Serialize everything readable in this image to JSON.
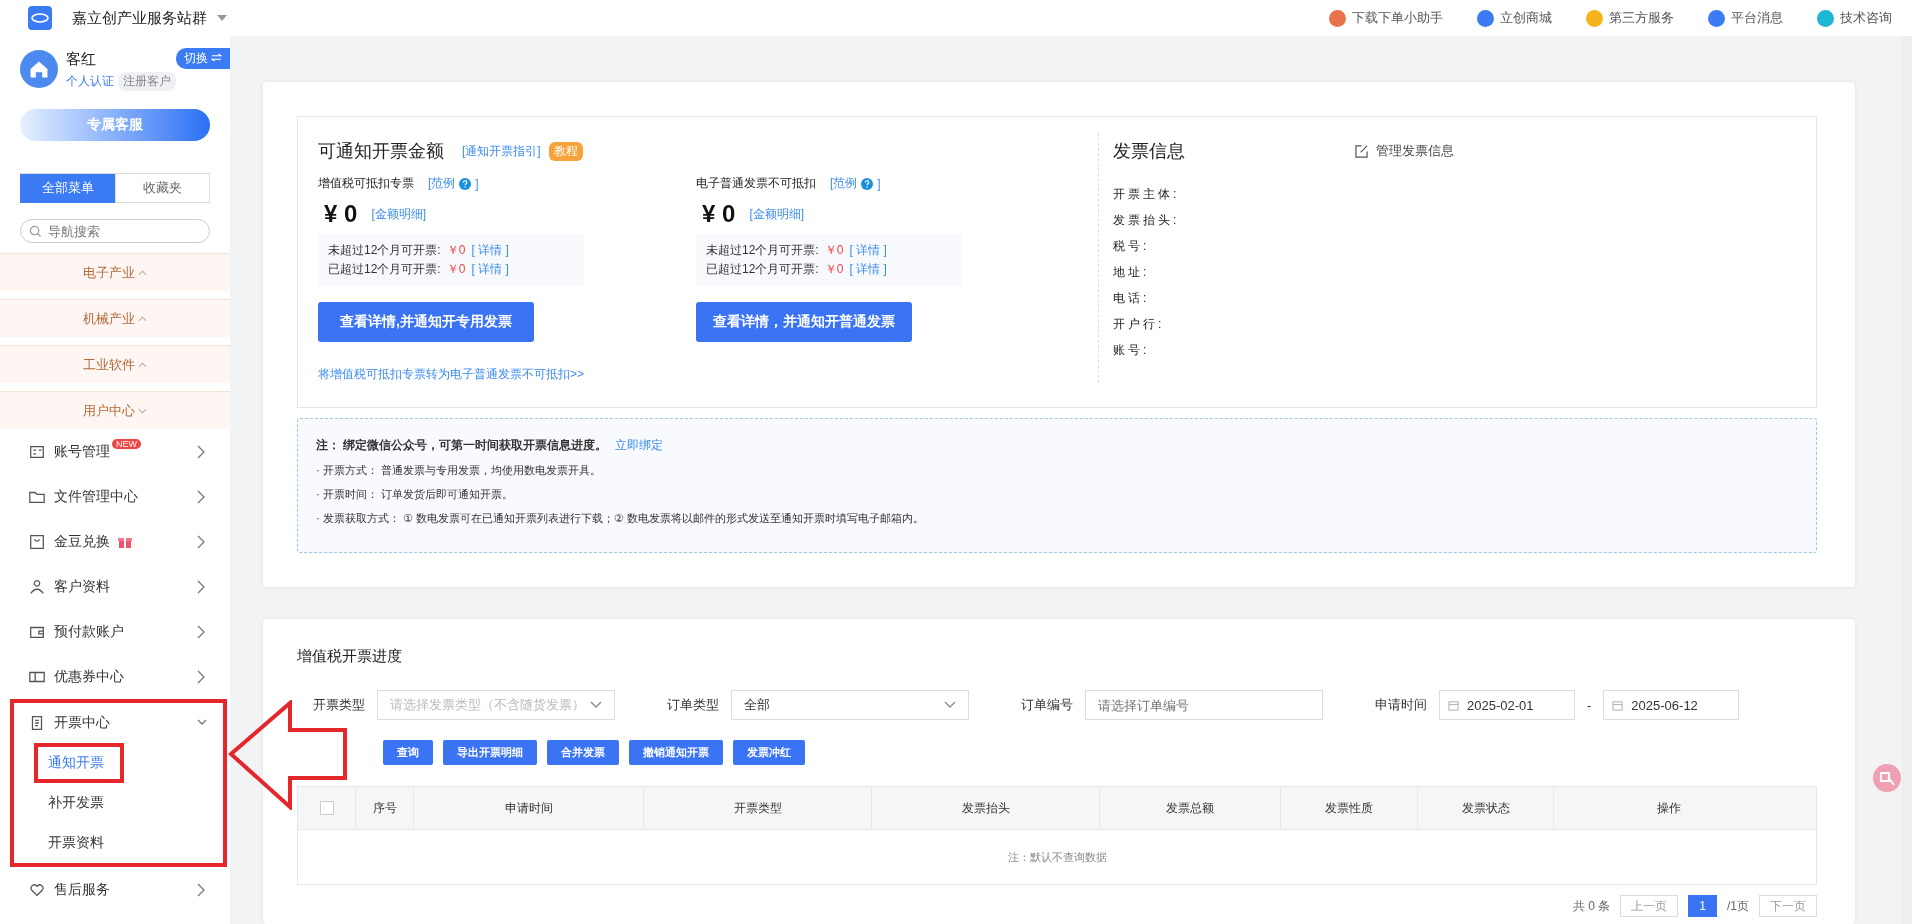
{
  "topbar": {
    "site": "嘉立创产业服务站群",
    "links": [
      {
        "label": "下载下单小助手",
        "color": "#e8734a"
      },
      {
        "label": "立创商城",
        "color": "#3b7cf5"
      },
      {
        "label": "第三方服务",
        "color": "#f5b31b"
      },
      {
        "label": "平台消息",
        "color": "#3b7cf5"
      },
      {
        "label": "技术咨询",
        "color": "#1fb7d6"
      }
    ]
  },
  "profile": {
    "name": "客红",
    "verify": "个人认证",
    "tag": "注册客户",
    "switch": "切换"
  },
  "service_button": "专属客服",
  "menu_tabs": [
    {
      "label": "全部菜单",
      "selected": true
    },
    {
      "label": "收藏夹",
      "selected": false
    }
  ],
  "nav_search": {
    "placeholder": "导航搜索"
  },
  "categories": [
    {
      "label": "电子产业",
      "expanded": false
    },
    {
      "label": "机械产业",
      "expanded": false
    },
    {
      "label": "工业软件",
      "expanded": false
    },
    {
      "label": "用户中心",
      "expanded": true
    }
  ],
  "menu": [
    {
      "label": "账号管理",
      "badge": "NEW",
      "gift": false,
      "expanded": false
    },
    {
      "label": "文件管理中心",
      "gift": false,
      "expanded": false
    },
    {
      "label": "金豆兑换",
      "gift": true,
      "expanded": false
    },
    {
      "label": "客户资料",
      "gift": false,
      "expanded": false
    },
    {
      "label": "预付款账户",
      "gift": false,
      "expanded": false
    },
    {
      "label": "优惠券中心",
      "gift": false,
      "expanded": false
    },
    {
      "label": "开票中心",
      "gift": false,
      "expanded": true,
      "annotated": true,
      "children": [
        {
          "label": "通知开票",
          "selected": true,
          "annotated": true
        },
        {
          "label": "补开发票",
          "selected": false,
          "annotated": false
        },
        {
          "label": "开票资料",
          "selected": false,
          "annotated": false
        }
      ]
    },
    {
      "label": "售后服务",
      "gift": false,
      "expanded": false
    }
  ],
  "amount": {
    "title": "可通知开票金额",
    "guide": "[通知开票指引]",
    "tutorial": "教程",
    "columns": [
      {
        "title": "增值税可抵扣专票",
        "example": "[范例",
        "example_end": "]",
        "total": "¥ 0",
        "detail": "[金额明细]",
        "lines": [
          {
            "label": "未超过12个月可开票:",
            "value": "￥0",
            "link": "[ 详情 ]"
          },
          {
            "label": "已超过12个月可开票:",
            "value": "￥0",
            "link": "[ 详情 ]"
          }
        ],
        "button": "查看详情,并通知开专用发票"
      },
      {
        "title": "电子普通发票不可抵扣",
        "example": "[范例",
        "example_end": "]",
        "total": "¥ 0",
        "detail": "[金额明细]",
        "lines": [
          {
            "label": "未超过12个月可开票:",
            "value": "￥0",
            "link": "[ 详情 ]"
          },
          {
            "label": "已超过12个月可开票:",
            "value": "￥0",
            "link": "[ 详情 ]"
          }
        ],
        "button": "查看详情，并通知开普通发票"
      }
    ],
    "convert_link": "将增值税可抵扣专票转为电子普通发票不可抵扣>>"
  },
  "invoice_info": {
    "title": "发票信息",
    "manage": "管理发票信息",
    "fields": [
      "开票主体:",
      "发票抬头:",
      "税号:",
      "地址:",
      "电话:",
      "开户行:",
      "账号:"
    ]
  },
  "notice": {
    "head": "注： 绑定微信公众号，可第一时间获取开票信息进度。",
    "bind": "立即绑定",
    "lines": [
      "· 开票方式： 普通发票与专用发票，均使用数电发票开具。",
      "· 开票时间： 订单发货后即可通知开票。",
      "· 发票获取方式： ① 数电发票可在已通知开票列表进行下载；② 数电发票将以邮件的形式发送至通知开票时填写电子邮箱内。"
    ]
  },
  "progress": {
    "title": "增值税开票进度",
    "filters": [
      {
        "label": "开票类型",
        "kind": "select",
        "placeholder": "请选择发票类型（不含随货发票）"
      },
      {
        "label": "订单类型",
        "kind": "select",
        "value": "全部"
      },
      {
        "label": "订单编号",
        "kind": "input",
        "placeholder": "请选择订单编号"
      }
    ],
    "date": {
      "label": "申请时间",
      "from": "2025-02-01",
      "sep": "-",
      "to": "2025-06-12"
    },
    "buttons": [
      "查询",
      "导出开票明细",
      "合并发票",
      "撤销通知开票",
      "发票冲红"
    ],
    "table": {
      "select_all_checked": false,
      "columns": [
        "序号",
        "申请时间",
        "开票类型",
        "发票抬头",
        "发票总额",
        "发票性质",
        "发票状态",
        "操作"
      ],
      "empty": "注：默认不查询数据"
    },
    "pagination": {
      "total": "共 0 条",
      "prev": "上一页",
      "page": "1",
      "pages": "/1页",
      "next": "下一页"
    }
  }
}
